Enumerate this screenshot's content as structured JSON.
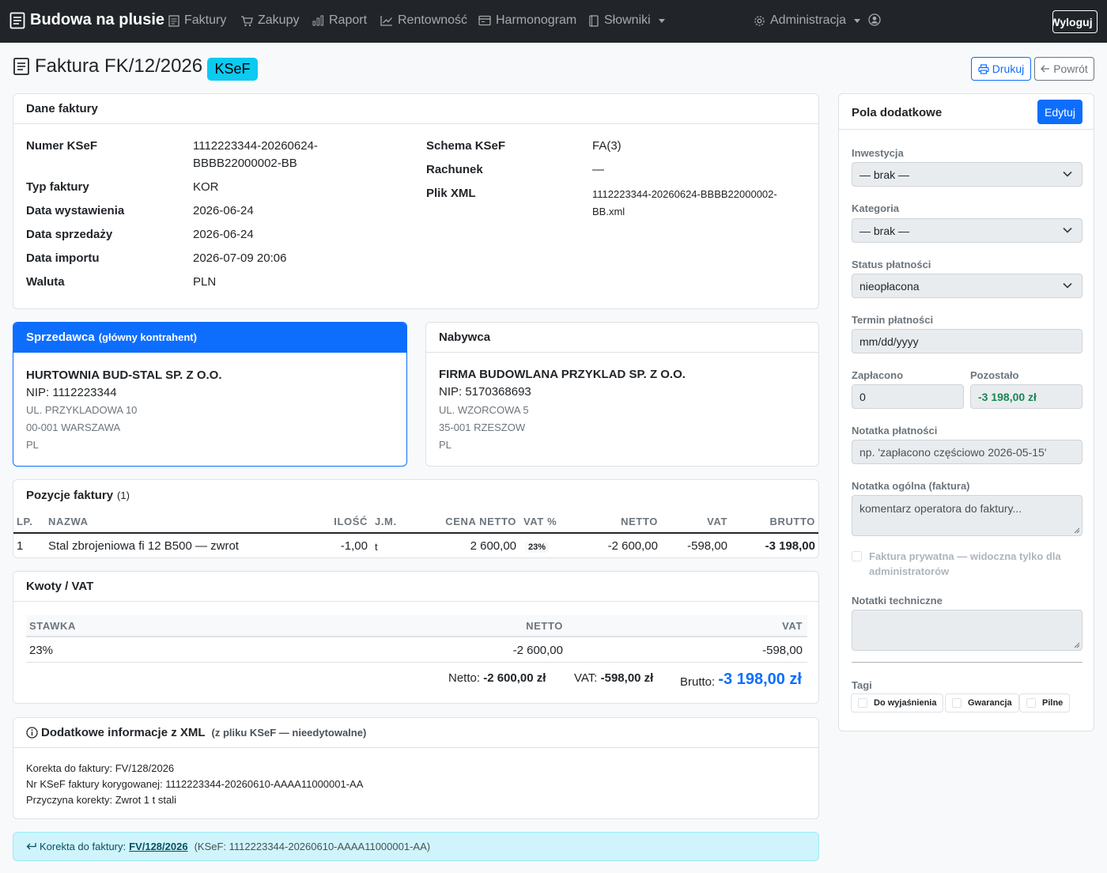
{
  "nav": {
    "brand": "Budowa na plusie",
    "items": [
      "Faktury",
      "Zakupy",
      "Raport",
      "Rentowność",
      "Harmonogram",
      "Słowniki"
    ],
    "admin": "Administracja",
    "logout": "Wyloguj"
  },
  "page": {
    "title": "Faktura FK/12/2026",
    "badge": "KSeF",
    "print": "Drukuj",
    "back": "Powrót"
  },
  "invoice_data": {
    "header": "Dane faktury",
    "ksef_number_label": "Numer KSeF",
    "ksef_number_line1": "1112223344-20260624-",
    "ksef_number_line2": "BBBB22000002-BB",
    "type_label": "Typ faktury",
    "type": "KOR",
    "issue_label": "Data wystawienia",
    "issue_date": "2026-06-24",
    "sale_label": "Data sprzedaży",
    "sale_date": "2026-06-24",
    "import_label": "Data importu",
    "import_date": "2026-07-09 20:06",
    "currency_label": "Waluta",
    "currency": "PLN",
    "schema_label": "Schema KSeF",
    "schema": "FA(3)",
    "account_label": "Rachunek",
    "account": "—",
    "xml_label": "Plik XML",
    "xml_line1": "1112223344-20260624-BBBB22000002-",
    "xml_line2": "BB.xml"
  },
  "seller": {
    "header": "Sprzedawca",
    "header_note": "(główny kontrahent)",
    "name": "HURTOWNIA BUD-STAL SP. Z O.O.",
    "nip": "NIP: 1112223344",
    "street": "UL. PRZYKLADOWA 10",
    "city": "00-001 WARSZAWA",
    "country": "PL"
  },
  "buyer": {
    "header": "Nabywca",
    "name": "FIRMA BUDOWLANA PRZYKLAD SP. Z O.O.",
    "nip": "NIP: 5170368693",
    "street": "UL. WZORCOWA 5",
    "city": "35-001 RZESZOW",
    "country": "PL"
  },
  "items": {
    "header": "Pozycje faktury",
    "count": "(1)",
    "columns": [
      "LP.",
      "NAZWA",
      "ILOŚĆ",
      "J.M.",
      "CENA NETTO",
      "VAT %",
      "NETTO",
      "VAT",
      "BRUTTO"
    ],
    "rows": [
      {
        "lp": "1",
        "name": "Stal zbrojeniowa fi 12 B500 — zwrot",
        "qty": "-1,00",
        "unit": "t",
        "price": "2 600,00",
        "vat_rate": "23%",
        "net": "-2 600,00",
        "vat": "-598,00",
        "gross": "-3 198,00"
      }
    ]
  },
  "vat": {
    "header": "Kwoty / VAT",
    "columns": [
      "STAWKA",
      "NETTO",
      "VAT"
    ],
    "rows": [
      {
        "rate": "23%",
        "net": "-2 600,00",
        "vat": "-598,00"
      }
    ],
    "net_label": "Netto:",
    "net_total": "-2 600,00 zł",
    "vat_label": "VAT:",
    "vat_total": "-598,00 zł",
    "gross_label": "Brutto:",
    "gross_total": "-3 198,00 zł"
  },
  "xml_info": {
    "header": "Dodatkowe informacje z XML",
    "note": "(z pliku KSeF — nieedytowalne)",
    "lines": [
      "Korekta do faktury: FV/128/2026",
      "Nr KSeF faktury korygowanej: 1112223344-20260610-AAAA11000001-AA",
      "Przyczyna korekty: Zwrot 1 t stali"
    ]
  },
  "correction": {
    "prefix": "Korekta do faktury:",
    "link": "FV/128/2026",
    "suffix": "(KSeF: 1112223344-20260610-AAAA11000001-AA)"
  },
  "sidebar": {
    "header": "Pola dodatkowe",
    "edit": "Edytuj",
    "investment_label": "Inwestycja",
    "investment_value": "— brak —",
    "category_label": "Kategoria",
    "category_value": "— brak —",
    "payment_status_label": "Status płatności",
    "payment_status_value": "nieopłacona",
    "due_label": "Termin płatności",
    "due_placeholder": "mm/dd/yyyy",
    "paid_label": "Zapłacono",
    "paid_value": "0",
    "remaining_label": "Pozostało",
    "remaining_value": "-3 198,00 zł",
    "payment_note_label": "Notatka płatności",
    "payment_note_placeholder": "np. 'zapłacono częściowo 2026-05-15'",
    "general_note_label": "Notatka ogólna (faktura)",
    "general_note_placeholder": "komentarz operatora do faktury...",
    "private_line1": "Faktura prywatna — widoczna tylko dla",
    "private_line2": "administratorów",
    "tech_notes_label": "Notatki techniczne",
    "tags_label": "Tagi",
    "tags": [
      "Do wyjaśnienia",
      "Gwarancja",
      "Pilne"
    ]
  },
  "colors": {
    "navbar": "#212529",
    "primary": "#0d6efd",
    "info": "#0dcaf0",
    "success": "#198754",
    "info_bg": "#cff4fc"
  },
  "icons": [
    "invoice-icon",
    "cart-icon",
    "bar-chart-icon",
    "trend-icon",
    "calendar-icon",
    "book-icon",
    "gear-icon",
    "user-icon",
    "printer-icon",
    "arrow-left-icon",
    "info-icon",
    "return-arrow-icon",
    "chevron-down-icon"
  ]
}
